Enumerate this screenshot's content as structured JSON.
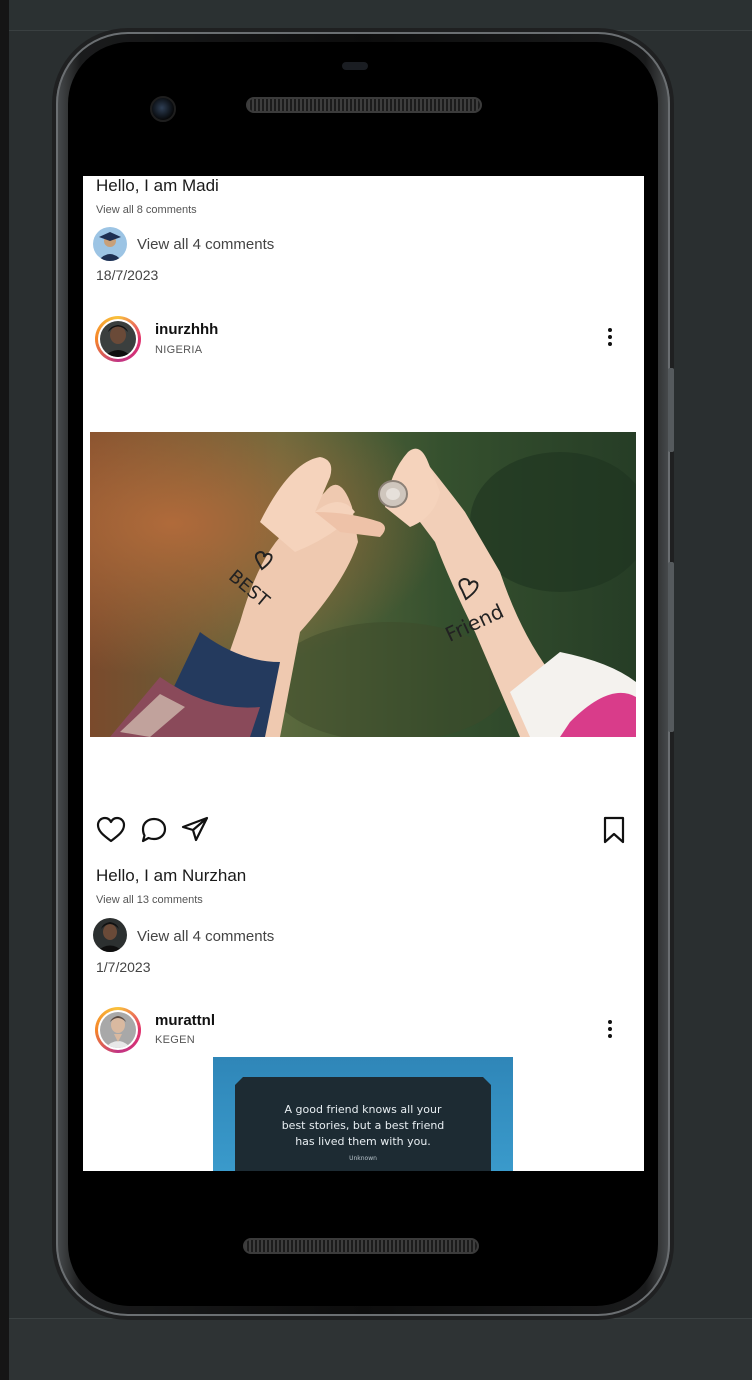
{
  "feed": {
    "partial_post": {
      "caption": "Hello, I am Madi",
      "view_all_comments": "View all 8 comments",
      "preview_comments": "View all 4 comments",
      "date": "18/7/2023"
    },
    "post": {
      "username": "inurzhhh",
      "location": "NIGERIA",
      "image_words": [
        "BEST",
        "Friend"
      ],
      "caption": "Hello, I am Nurzhan",
      "view_all_comments": "View all 13 comments",
      "preview_comments": "View all 4 comments",
      "date": "1/7/2023"
    },
    "next_post": {
      "username": "murattnl",
      "location": "KEGEN",
      "quote": [
        "A good friend knows all your",
        "best stories, but a best friend",
        "has lived them with you."
      ],
      "quote_author": "Unknown"
    }
  },
  "icons": [
    "heart-icon",
    "comment-icon",
    "share-icon",
    "bookmark-icon",
    "more-options-icon"
  ],
  "colors": {
    "story_ring": "#e1306c",
    "background": "#2a2f30"
  }
}
